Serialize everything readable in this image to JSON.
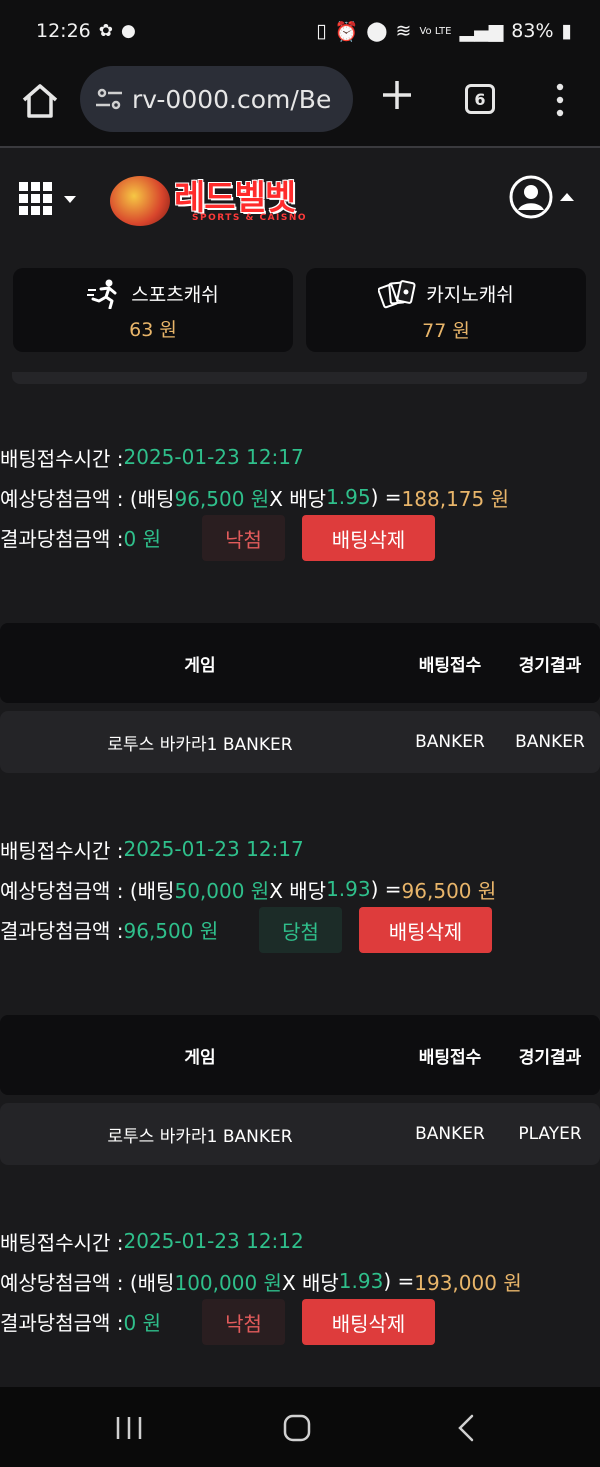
{
  "status_bar": {
    "time": "12:26",
    "battery": "83%",
    "network": "Vo LTE"
  },
  "browser": {
    "url": "rv-0000.com/Be",
    "tab_count": "6"
  },
  "site": {
    "logo_text": "레드벨벳",
    "logo_sub": "SPORTS & CAISNO"
  },
  "cash": {
    "sports_label": "스포츠캐쉬",
    "sports_amount": "63 원",
    "casino_label": "카지노캐쉬",
    "casino_amount": "77 원"
  },
  "labels": {
    "time_label": "배팅접수시간 : ",
    "expected_label": "예상당첨금액 : (배팅 ",
    "x_odds": " X 배당 ",
    "close_eq": " ) = ",
    "result_label": "결과당첨금액 : ",
    "col_game": "게임",
    "col_bet": "배팅접수",
    "col_result": "경기결과",
    "delete": "배팅삭제"
  },
  "bets": [
    {
      "time": "2025-01-23 12:17",
      "stake": "96,500 원",
      "odds": "1.95",
      "expected": "188,175 원",
      "result_amount": "0 원",
      "status": "낙첨",
      "game": "로투스 바카라1 BANKER",
      "bet_pick": "BANKER",
      "game_result": "BANKER"
    },
    {
      "time": "2025-01-23 12:17",
      "stake": "50,000 원",
      "odds": "1.93",
      "expected": "96,500 원",
      "result_amount": "96,500 원",
      "status": "당첨",
      "game": "로투스 바카라1 BANKER",
      "bet_pick": "BANKER",
      "game_result": "PLAYER"
    },
    {
      "time": "2025-01-23 12:12",
      "stake": "100,000 원",
      "odds": "1.93",
      "expected": "193,000 원",
      "result_amount": "0 원",
      "status": "낙첨"
    }
  ]
}
